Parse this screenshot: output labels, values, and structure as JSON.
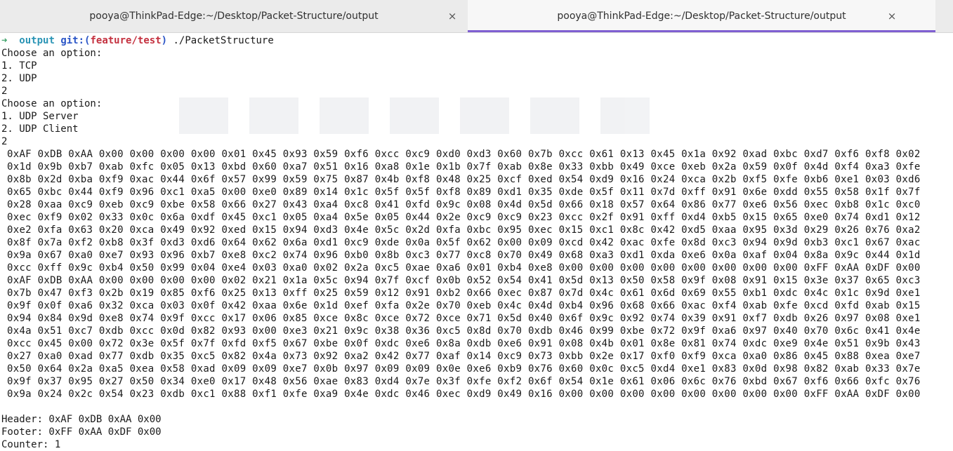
{
  "tabs": [
    {
      "title": "pooya@ThinkPad-Edge:~/Desktop/Packet-Structure/output",
      "active": false
    },
    {
      "title": "pooya@ThinkPad-Edge:~/Desktop/Packet-Structure/output",
      "active": true
    }
  ],
  "close_glyph": "×",
  "prompt": {
    "arrow": "➜",
    "dir": "output",
    "git_label": "git:(",
    "branch": "feature/test",
    "git_close": ")",
    "command": "./PacketStructure"
  },
  "menu1": {
    "title": "Choose an option:",
    "opt1": "1. TCP",
    "opt2": "2. UDP",
    "input": "2"
  },
  "menu2": {
    "title": "Choose an option:",
    "opt1": "1. UDP Server",
    "opt2": "2. UDP Client",
    "input": "2"
  },
  "hex_rows": [
    "0xAF 0xDB 0xAA 0x00 0x00 0x00 0x00 0x01 0x45 0x93 0x59 0xf6 0xcc 0xc9 0xd0 0xd3 0x60 0x7b 0xcc 0x61 0x13 0x45 0x1a 0x92 0xad 0xbc 0xd7 0xf6 0xf8 0x02",
    "0x1d 0x9b 0xb7 0xab 0xfc 0x05 0x13 0xbd 0x60 0xa7 0x51 0x16 0xa8 0x1e 0x1b 0x7f 0xab 0x8e 0x33 0xbb 0x49 0xce 0xeb 0x2a 0x59 0x0f 0x4d 0xf4 0xa3 0xfe",
    "0x8b 0x2d 0xba 0xf9 0xac 0x44 0x6f 0x57 0x99 0x59 0x75 0x87 0x4b 0xf8 0x48 0x25 0xcf 0xed 0x54 0xd9 0x16 0x24 0xca 0x2b 0xf5 0xfe 0xb6 0xe1 0x03 0xd6",
    "0x65 0xbc 0x44 0xf9 0x96 0xc1 0xa5 0x00 0xe0 0x89 0x14 0x1c 0x5f 0x5f 0xf8 0x89 0xd1 0x35 0xde 0x5f 0x11 0x7d 0xff 0x91 0x6e 0xdd 0x55 0x58 0x1f 0x7f",
    "0x28 0xaa 0xc9 0xeb 0xc9 0xbe 0x58 0x66 0x27 0x43 0xa4 0xc8 0x41 0xfd 0x9c 0x08 0x4d 0x5d 0x66 0x18 0x57 0x64 0x86 0x77 0xe6 0x56 0xec 0xb8 0x1c 0xc0",
    "0xec 0xf9 0x02 0x33 0x0c 0x6a 0xdf 0x45 0xc1 0x05 0xa4 0x5e 0x05 0x44 0x2e 0xc9 0xc9 0x23 0xcc 0x2f 0x91 0xff 0xd4 0xb5 0x15 0x65 0xe0 0x74 0xd1 0x12",
    "0xe2 0xfa 0x63 0x20 0xca 0x49 0x92 0xed 0x15 0x94 0xd3 0x4e 0x5c 0x2d 0xfa 0xbc 0x95 0xec 0x15 0xc1 0x8c 0x42 0xd5 0xaa 0x95 0x3d 0x29 0x26 0x76 0xa2",
    "0x8f 0x7a 0xf2 0xb8 0x3f 0xd3 0xd6 0x64 0x62 0x6a 0xd1 0xc9 0xde 0x0a 0x5f 0x62 0x00 0x09 0xcd 0x42 0xac 0xfe 0x8d 0xc3 0x94 0x9d 0xb3 0xc1 0x67 0xac",
    "0x9a 0x67 0xa0 0xe7 0x93 0x96 0xb7 0xe8 0xc2 0x74 0x96 0xb0 0x8b 0xc3 0x77 0xc8 0x70 0x49 0x68 0xa3 0xd1 0xda 0xe6 0x0a 0xaf 0x04 0x8a 0x9c 0x44 0x1d",
    "0xcc 0xff 0x9c 0xb4 0x50 0x99 0x04 0xe4 0x03 0xa0 0x02 0x2a 0xc5 0xae 0xa6 0x01 0xb4 0xe8 0x00 0x00 0x00 0x00 0x00 0x00 0x00 0x00 0xFF 0xAA 0xDF 0x00",
    "0xAF 0xDB 0xAA 0x00 0x00 0x00 0x00 0x02 0x21 0x1a 0x5c 0x94 0x7f 0xcf 0x0b 0x52 0x54 0x41 0x5d 0x13 0x50 0x58 0x9f 0x08 0x91 0x15 0x3e 0x37 0x65 0xc3",
    "0x7b 0x47 0xf3 0x2b 0x19 0x85 0xf6 0x25 0x13 0xff 0x25 0x59 0x12 0x91 0xb2 0x66 0xec 0x87 0x7d 0x4c 0x61 0x6d 0x69 0x55 0xb1 0xdc 0x4c 0x1c 0x9d 0xe1",
    "0x9f 0x0f 0xa6 0x32 0xca 0x03 0x0f 0x42 0xaa 0x6e 0x1d 0xef 0xfa 0x2e 0x70 0xeb 0x4c 0x4d 0xb4 0x96 0x68 0x66 0xac 0xf4 0xab 0xfe 0xcd 0xfd 0xab 0x15",
    "0x94 0x84 0x9d 0xe8 0x74 0x9f 0xcc 0x17 0x06 0x85 0xce 0x8c 0xce 0x72 0xce 0x71 0x5d 0x40 0x6f 0x9c 0x92 0x74 0x39 0x91 0xf7 0xdb 0x26 0x97 0x08 0xe1",
    "0x4a 0x51 0xc7 0xdb 0xcc 0x0d 0x82 0x93 0x00 0xe3 0x21 0x9c 0x38 0x36 0xc5 0x8d 0x70 0xdb 0x46 0x99 0xbe 0x72 0x9f 0xa6 0x97 0x40 0x70 0x6c 0x41 0x4e",
    "0xcc 0x45 0x00 0x72 0x3e 0x5f 0x7f 0xfd 0xf5 0x67 0xbe 0x0f 0xdc 0xe6 0x8a 0xdb 0xe6 0x91 0x08 0x4b 0x01 0x8e 0x81 0x74 0xdc 0xe9 0x4e 0x51 0x9b 0x43",
    "0x27 0xa0 0xad 0x77 0xdb 0x35 0xc5 0x82 0x4a 0x73 0x92 0xa2 0x42 0x77 0xaf 0x14 0xc9 0x73 0xbb 0x2e 0x17 0xf0 0xf9 0xca 0xa0 0x86 0x45 0x88 0xea 0xe7",
    "0x50 0x64 0x2a 0xa5 0xea 0x58 0xad 0x09 0x09 0xe7 0x0b 0x97 0x09 0x09 0x0e 0xe6 0xb9 0x76 0x60 0x0c 0xc5 0xd4 0xe1 0x83 0x0d 0x98 0x82 0xab 0x33 0x7e",
    "0x9f 0x37 0x95 0x27 0x50 0x34 0xe0 0x17 0x48 0x56 0xae 0x83 0xd4 0x7e 0x3f 0xfe 0xf2 0x6f 0x54 0x1e 0x61 0x06 0x6c 0x76 0xbd 0x67 0xf6 0x66 0xfc 0x76",
    "0x9a 0x24 0x2c 0x54 0x23 0xdb 0xc1 0x88 0xf1 0xfe 0xa9 0x4e 0xdc 0x46 0xec 0xd9 0x49 0x16 0x00 0x00 0x00 0x00 0x00 0x00 0x00 0x00 0xFF 0xAA 0xDF 0x00"
  ],
  "summary": {
    "header": "Header: 0xAF 0xDB 0xAA 0x00",
    "footer": "Footer: 0xFF 0xAA 0xDF 0x00",
    "counter": "Counter: 1"
  }
}
